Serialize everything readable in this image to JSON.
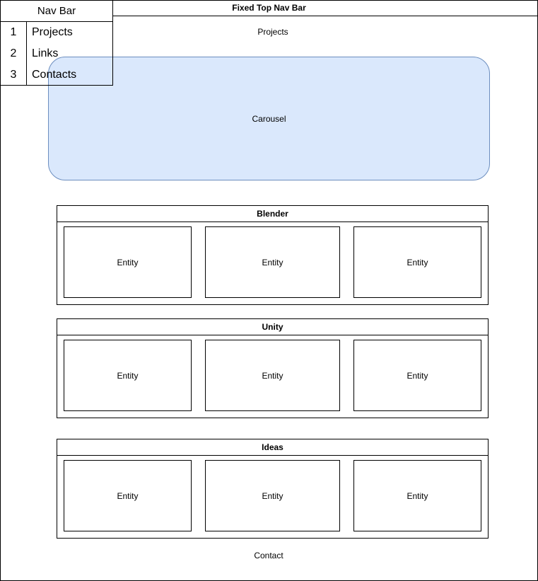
{
  "top_bar": {
    "title": "Fixed Top Nav Bar"
  },
  "projects_label": "Projects",
  "carousel": {
    "label": "Carousel",
    "fill": "#dae8fc",
    "stroke": "#6c8ebf"
  },
  "nav_box": {
    "title": "Nav Bar",
    "items": [
      {
        "num": "1",
        "label": "Projects"
      },
      {
        "num": "2",
        "label": "Links"
      },
      {
        "num": "3",
        "label": "Contacts"
      }
    ]
  },
  "sections": [
    {
      "title": "Blender",
      "entities": [
        "Entity",
        "Entity",
        "Entity"
      ]
    },
    {
      "title": "Unity",
      "entities": [
        "Entity",
        "Entity",
        "Entity"
      ]
    },
    {
      "title": "Ideas",
      "entities": [
        "Entity",
        "Entity",
        "Entity"
      ]
    }
  ],
  "contact_label": "Contact"
}
